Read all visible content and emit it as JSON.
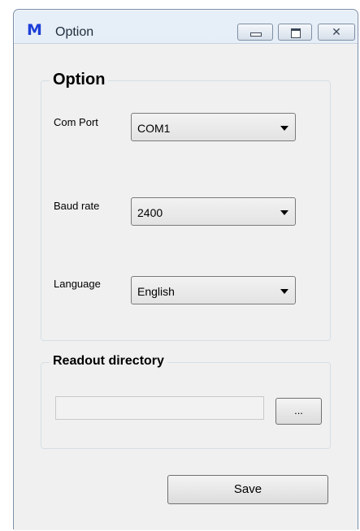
{
  "window": {
    "icon": "app-m-icon",
    "icon_glyph": "M",
    "title": "Option",
    "close_glyph": "✕"
  },
  "option_group": {
    "title": "Option",
    "com_port": {
      "label": "Com Port",
      "value": "COM1"
    },
    "baud_rate": {
      "label": "Baud rate",
      "value": "2400"
    },
    "language": {
      "label": "Language",
      "value": "English"
    }
  },
  "readout_group": {
    "title": "Readout directory",
    "path_value": "",
    "browse_label": "..."
  },
  "save_label": "Save",
  "colors": {
    "icon_blue": "#1c3fd8",
    "client_bg": "#f0f0f0"
  }
}
